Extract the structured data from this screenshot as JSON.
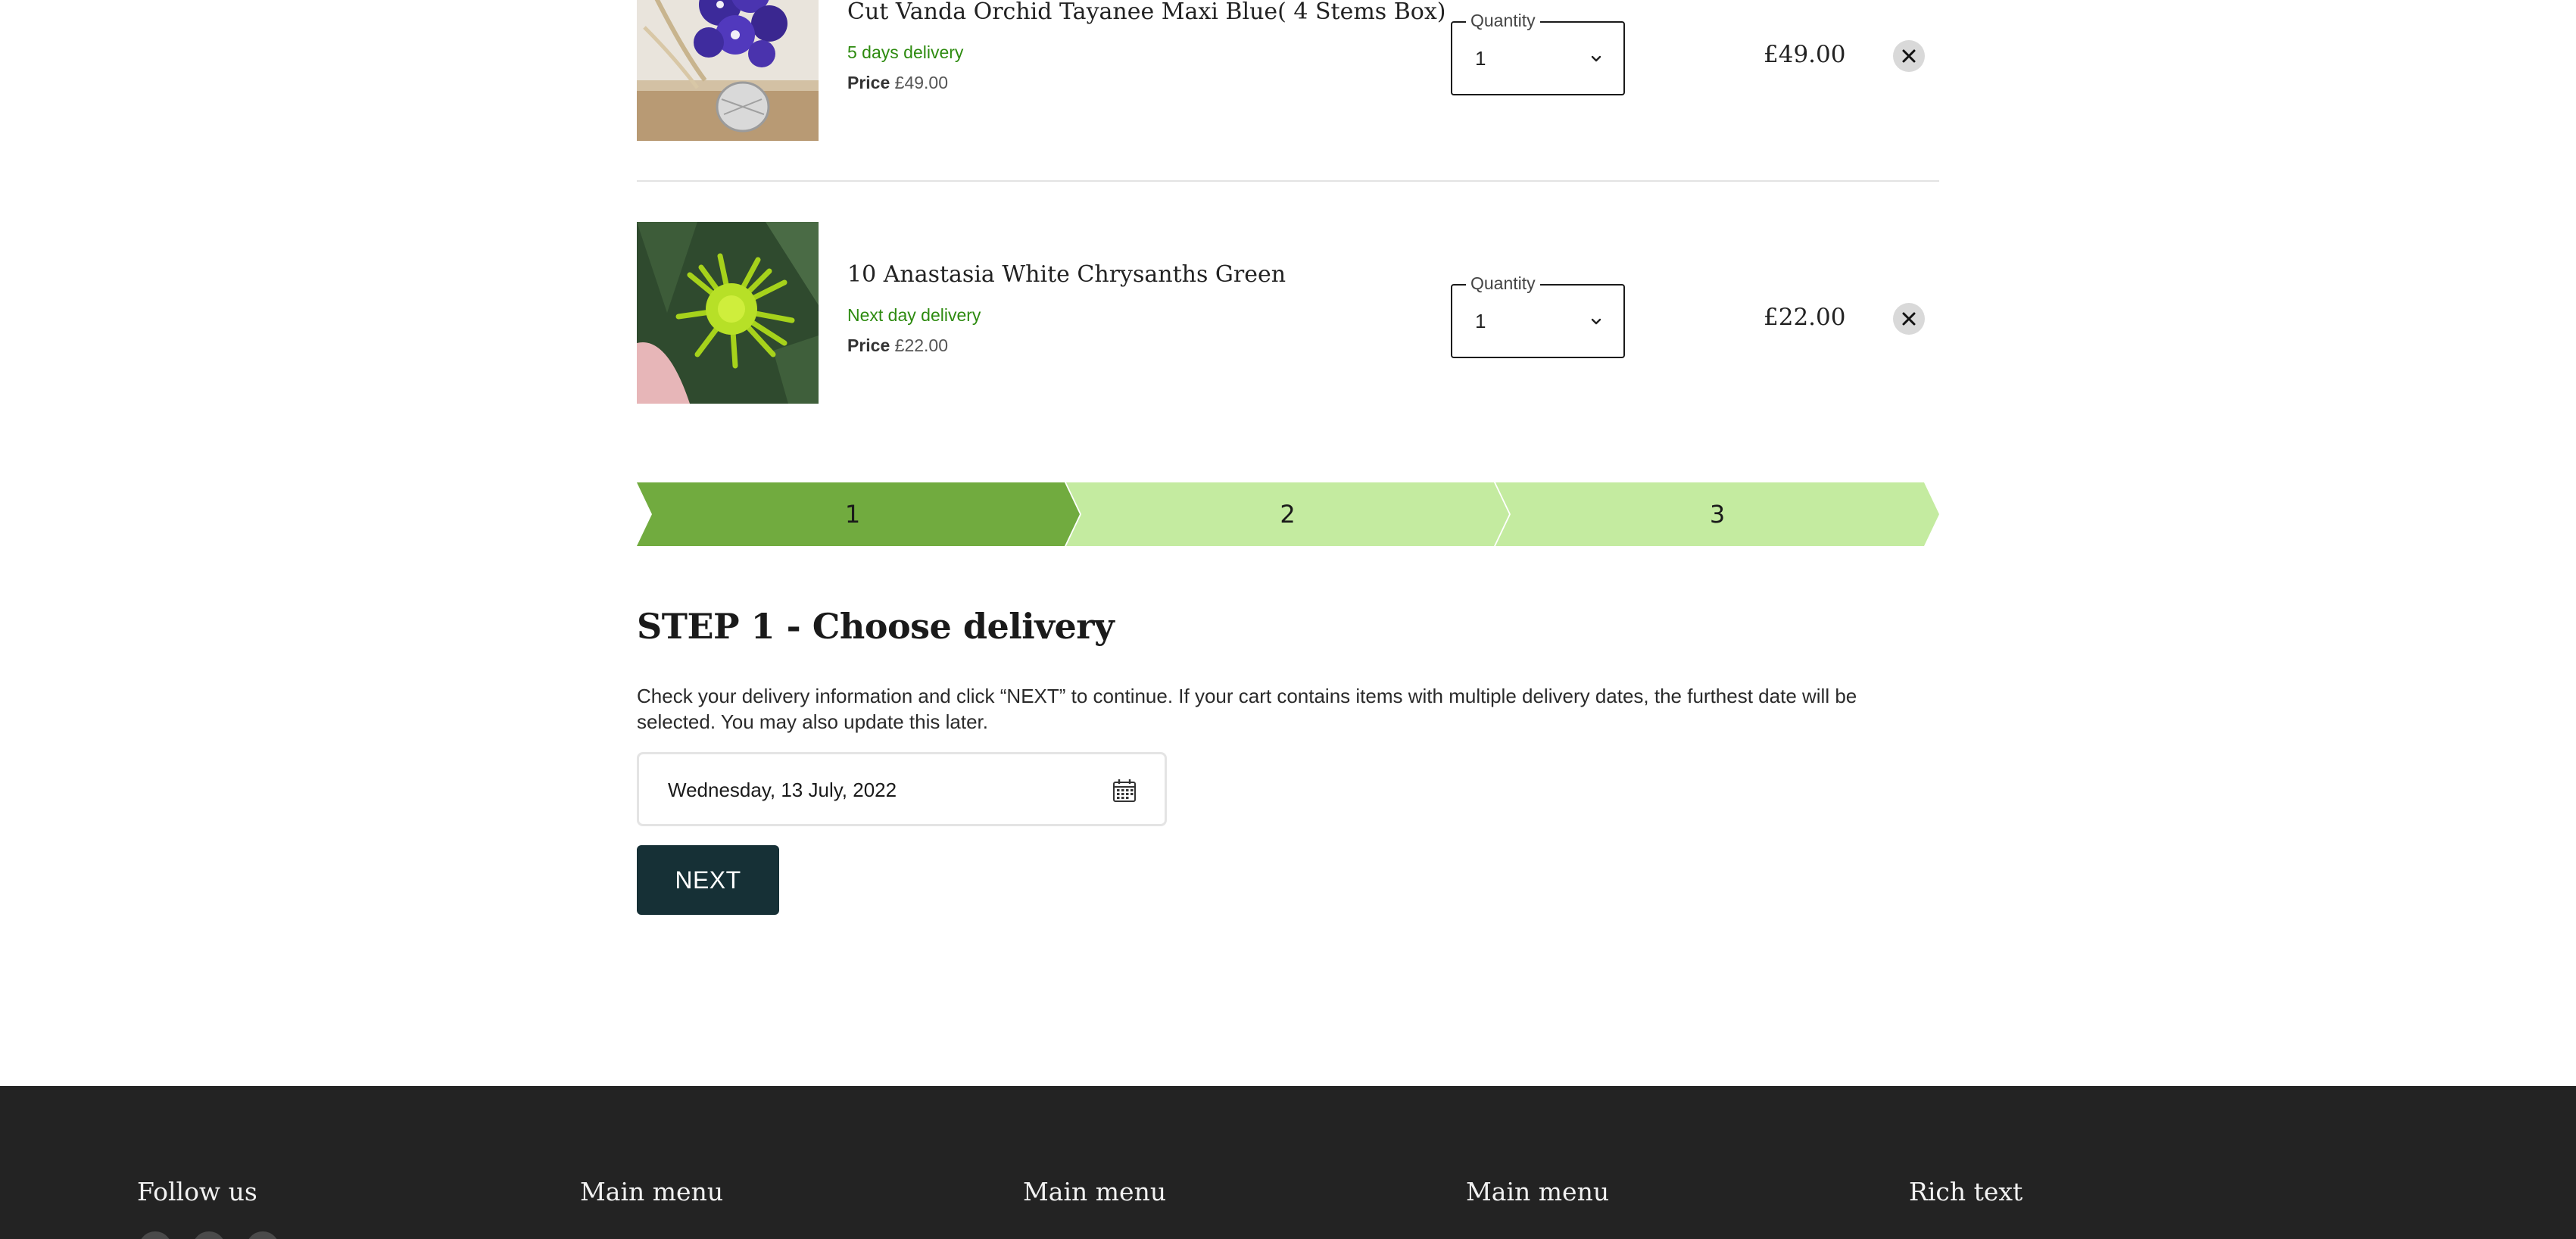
{
  "cart": {
    "items": [
      {
        "title": "Cut Vanda Orchid Tayanee Maxi Blue( 4 Stems Box)",
        "delivery": "5 days delivery",
        "price_label": "Price",
        "price": "£49.00",
        "quantity_label": "Quantity",
        "quantity": "1",
        "line_total": "£49.00",
        "image_icon": "vanda-orchid-photo"
      },
      {
        "title": "10 Anastasia White Chrysanths Green",
        "delivery": "Next day delivery",
        "price_label": "Price",
        "price": "£22.00",
        "quantity_label": "Quantity",
        "quantity": "1",
        "line_total": "£22.00",
        "image_icon": "chrysanthemum-photo"
      }
    ]
  },
  "steps": {
    "items": [
      {
        "label": "1",
        "active": true
      },
      {
        "label": "2",
        "active": false
      },
      {
        "label": "3",
        "active": false
      }
    ],
    "colors": {
      "active": "#71ab3f",
      "inactive": "#c4eba0"
    }
  },
  "delivery_step": {
    "heading": "STEP 1 - Choose delivery",
    "description": "Check your delivery information and click “NEXT” to continue. If your cart contains items with multiple delivery dates, the furthest date will be selected. You may also update this later.",
    "date_value": "Wednesday, 13 July, 2022",
    "next_label": "NEXT"
  },
  "footer": {
    "columns": [
      "Follow us",
      "Main menu",
      "Main menu",
      "Main menu",
      "Rich text"
    ]
  },
  "colors": {
    "delivery_green": "#2e8b10",
    "next_button": "#163036",
    "footer_bg": "#232323"
  }
}
